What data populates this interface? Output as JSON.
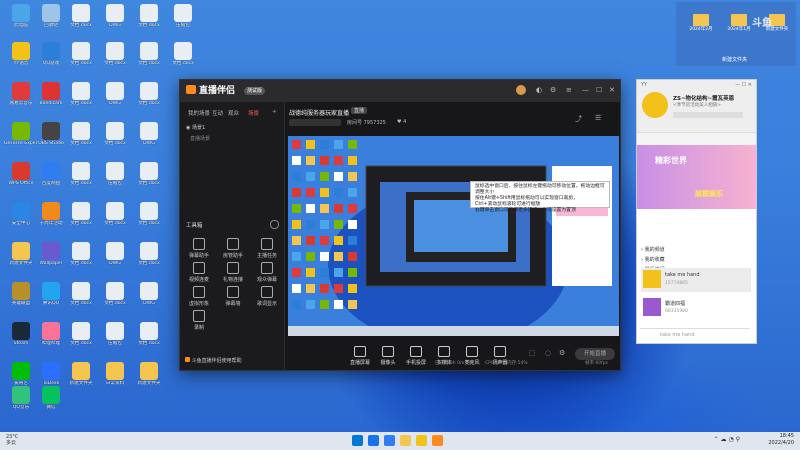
{
  "desktop": {
    "icons": [
      {
        "label": "此电脑",
        "color": "#4aa6e8"
      },
      {
        "label": "回收站",
        "color": "#9fc4e8"
      },
      {
        "label": "YY语音",
        "color": "#f2c21b"
      },
      {
        "label": "QQ游戏",
        "color": "#2b7fd8"
      },
      {
        "label": "网易云音乐",
        "color": "#e03a3a"
      },
      {
        "label": "Bandicam",
        "color": "#d33"
      },
      {
        "label": "GeForce Experience",
        "color": "#76b900"
      },
      {
        "label": "OBS Studio",
        "color": "#444"
      },
      {
        "label": "WPS Office",
        "color": "#d83a2c"
      },
      {
        "label": "百度网盘",
        "color": "#2f7df0"
      },
      {
        "label": "安全中心",
        "color": "#2a86e4"
      },
      {
        "label": "十周年活动",
        "color": "#f08a1c"
      },
      {
        "label": "新建文件夹",
        "color": "#f4c550"
      },
      {
        "label": "Wallpaper",
        "color": "#6a5acd"
      },
      {
        "label": "英雄联盟",
        "color": "#b8902a"
      },
      {
        "label": "腾讯QQ",
        "color": "#22a4f0"
      },
      {
        "label": "Steam",
        "color": "#1b2838"
      },
      {
        "label": "哔哩哔哩",
        "color": "#fb7299"
      },
      {
        "label": "爱奇艺",
        "color": "#00be06"
      },
      {
        "label": "ToDesk",
        "color": "#2b6fff"
      },
      {
        "label": "QQ音乐",
        "color": "#31c27c"
      },
      {
        "label": "微信",
        "color": "#07c160"
      }
    ],
    "docs": [
      {
        "label": "文档.docx"
      },
      {
        "label": "DWG"
      },
      {
        "label": "文档.docx"
      },
      {
        "label": "压缩包"
      },
      {
        "label": "文档.docx"
      },
      {
        "label": "文档.docx"
      },
      {
        "label": "文档.docx"
      },
      {
        "label": "文档.docx"
      },
      {
        "label": "文档.docx"
      },
      {
        "label": "DWG"
      },
      {
        "label": "文档.docx"
      },
      {
        "label": "文档.docx"
      }
    ],
    "folders": [
      {
        "label": "新建文件夹"
      },
      {
        "label": "日常资料"
      },
      {
        "label": "新建文件夹"
      }
    ],
    "watermark": "斗鱼"
  },
  "window": {
    "app_name": "直播伴侣",
    "badge": "测试版",
    "tabs": [
      "我的场景",
      "互动",
      "观众",
      "场景"
    ],
    "scene_label": "场景1",
    "scene_sub": "直播场景",
    "tools_title": "工具箱",
    "tools": [
      {
        "label": "弹幕助手"
      },
      {
        "label": "房管助手"
      },
      {
        "label": "主播任务"
      },
      {
        "label": "视频连麦"
      },
      {
        "label": "礼物连接"
      },
      {
        "label": "观众弹幕"
      },
      {
        "label": "虚拟形象"
      },
      {
        "label": "弹幕墙"
      },
      {
        "label": "歌词显示"
      },
      {
        "label": "录制"
      }
    ],
    "room_title": "战德纯服务器玩家直播",
    "room_tag": "直播",
    "room_info": "房间号 7957325",
    "likes": "4",
    "bottom_buttons": [
      {
        "label": "直播屏幕"
      },
      {
        "label": "摄像头"
      },
      {
        "label": "手机投屏"
      },
      {
        "label": "多媒体"
      },
      {
        "label": "麦克风"
      },
      {
        "label": "扬声器"
      }
    ],
    "go_live": "开始直播",
    "status_left": "已开播 0h 0m 0s",
    "status_mid": "CPU:12%  内存:54%",
    "status_right": "帧率 60fps",
    "bottom_note": "斗鱼直播伴侣使用帮助"
  },
  "tooltip": {
    "lines": [
      "鼠标选中窗口后，按住鼠标左键拖动可移动位置，拖动边框可调整大小",
      "按住Alt键+Shift用鼠标拖动可以实现窗口裁剪，",
      "Ctrl+滚动鼠标滚轮可进行缩放",
      "右键单击窗口可选择更多操作，也可设置为置顶"
    ]
  },
  "yy": {
    "title": "YY",
    "channel": "ZS~物化结构~霞瓦英恩",
    "sub": "<季节房活动美人相随>",
    "banner": "精彩世界",
    "banner2": "超模娱乐",
    "list": [
      {
        "label": "我的频道"
      },
      {
        "label": "我的收藏"
      },
      {
        "label": "最近访问"
      }
    ],
    "rooms": [
      {
        "name": "take me hand",
        "meta": "15774865"
      },
      {
        "name": "霸道四福",
        "meta": "68335980"
      }
    ],
    "search_placeholder": "take me hand"
  },
  "topright": {
    "folders": [
      {
        "label": "2024年2月"
      },
      {
        "label": "2024年1月"
      },
      {
        "label": "新建文件夹"
      }
    ],
    "caption": "新建文件夹"
  },
  "taskbar": {
    "weather_temp": "23°C",
    "weather_desc": "多云",
    "time": "18:45",
    "date": "2022/4/20",
    "apps": [
      {
        "color": "#0078d4"
      },
      {
        "color": "#1a73e8"
      },
      {
        "color": "#2f7df0"
      },
      {
        "color": "#f4c550"
      },
      {
        "color": "#f2c21b"
      },
      {
        "color": "#ff8a1d"
      }
    ]
  }
}
